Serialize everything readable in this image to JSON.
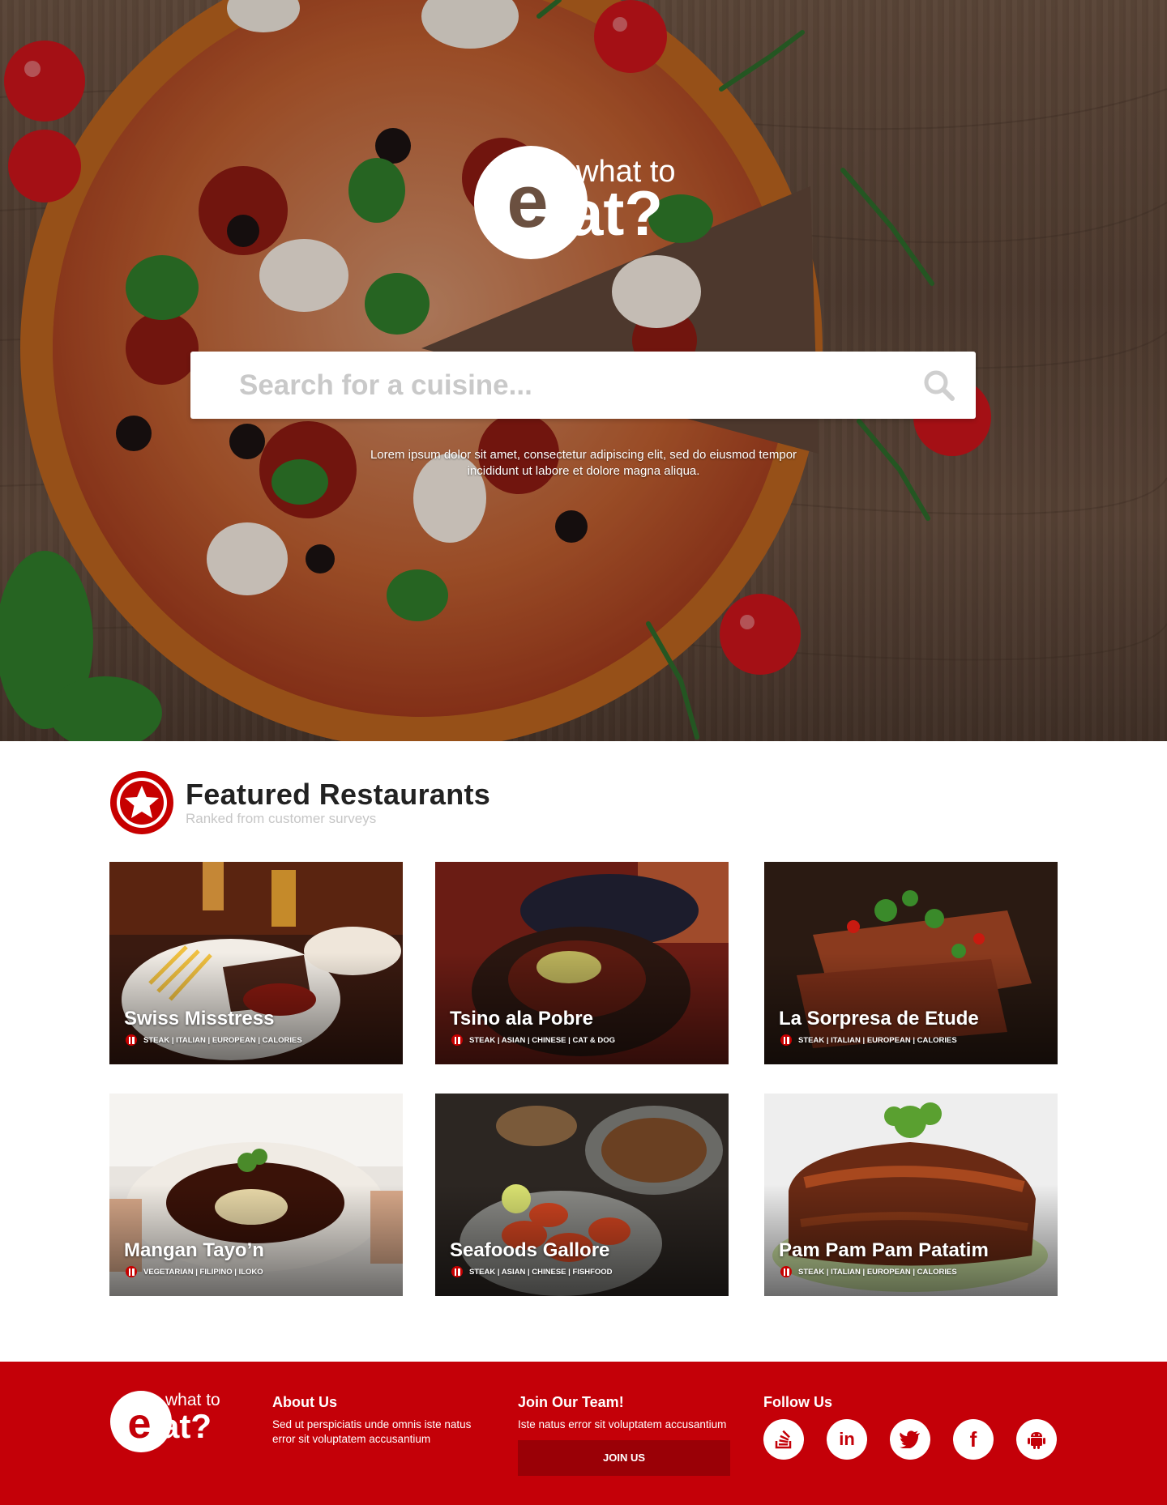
{
  "brand": {
    "logo_top": "what to",
    "logo_bottom": "at?"
  },
  "hero": {
    "search_placeholder": "Search for a cuisine...",
    "subtitle_line1": "Lorem ipsum dolor sit amet, consectetur adipiscing elit, sed do eiusmod tempor",
    "subtitle_line2": "incididunt ut labore et dolore magna aliqua."
  },
  "featured": {
    "title": "Featured Restaurants",
    "subtitle": "Ranked from customer surveys",
    "restaurants": [
      {
        "name": "Swiss Misstress",
        "tags": "STEAK | ITALIAN | EUROPEAN | CALORIES"
      },
      {
        "name": "Tsino ala Pobre",
        "tags": "STEAK | ASIAN | CHINESE | CAT & DOG"
      },
      {
        "name": "La Sorpresa de Etude",
        "tags": "STEAK | ITALIAN | EUROPEAN | CALORIES"
      },
      {
        "name": "Mangan Tayo’n",
        "tags": "VEGETARIAN | FILIPINO | ILOKO"
      },
      {
        "name": "Seafoods Gallore",
        "tags": "STEAK | ASIAN | CHINESE | FISHFOOD"
      },
      {
        "name": "Pam Pam Pam Patatim",
        "tags": "STEAK | ITALIAN | EUROPEAN | CALORIES"
      }
    ]
  },
  "footer": {
    "about_title": "About Us",
    "about_text_1": "Sed ut perspiciatis unde omnis iste natus",
    "about_text_2": "error sit voluptatem accusantium",
    "join_title": "Join Our Team!",
    "join_text": "Iste natus error sit voluptatem accusantium",
    "join_button": "JOIN US",
    "follow_title": "Follow Us",
    "socials": [
      "stackoverflow-icon",
      "linkedin-icon",
      "twitter-icon",
      "facebook-icon",
      "android-icon"
    ],
    "linkedin_glyph": "in",
    "facebook_glyph": "f"
  },
  "colors": {
    "brand_red": "#c40008",
    "button_dark_red": "#9a0006",
    "badge_red": "#c70000"
  }
}
